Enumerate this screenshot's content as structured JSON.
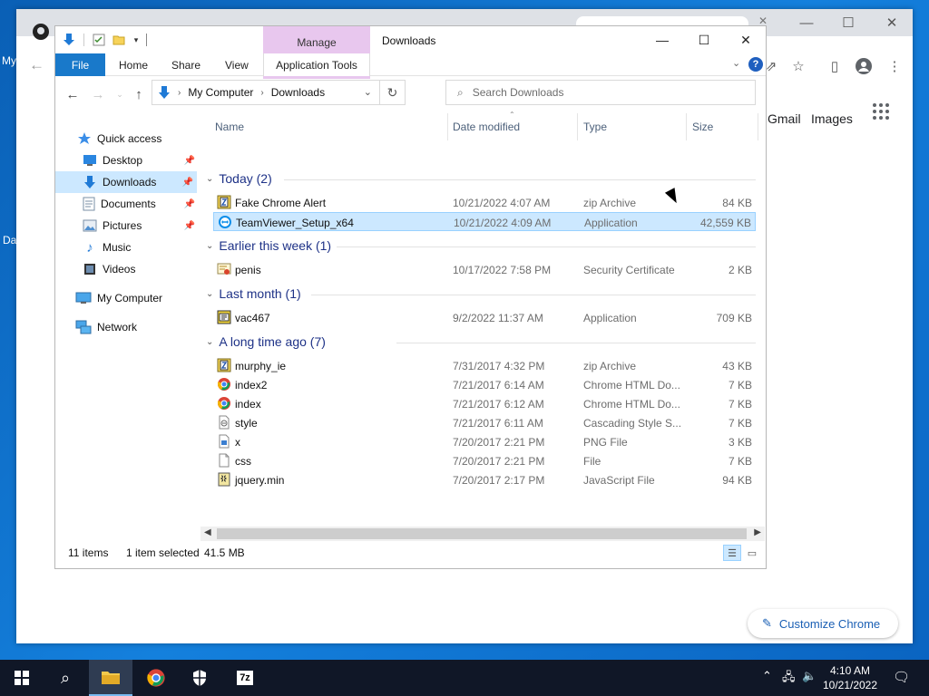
{
  "desktop": {
    "fragments": [
      "My",
      "Da"
    ]
  },
  "chrome": {
    "links": [
      "Gmail",
      "Images"
    ],
    "customize_label": "Customize Chrome"
  },
  "explorer": {
    "title": "Downloads",
    "manage_label": "Manage",
    "ribbon_tabs": [
      "File",
      "Home",
      "Share",
      "View",
      "Application Tools"
    ],
    "breadcrumb": [
      "My Computer",
      "Downloads"
    ],
    "search_placeholder": "Search Downloads",
    "sidebar": [
      {
        "label": "Quick access",
        "icon": "star-icon"
      },
      {
        "label": "Desktop",
        "icon": "desktop-icon",
        "pinned": true
      },
      {
        "label": "Downloads",
        "icon": "download-icon",
        "pinned": true,
        "selected": true
      },
      {
        "label": "Documents",
        "icon": "documents-icon",
        "pinned": true
      },
      {
        "label": "Pictures",
        "icon": "pictures-icon",
        "pinned": true
      },
      {
        "label": "Music",
        "icon": "music-icon"
      },
      {
        "label": "Videos",
        "icon": "videos-icon"
      },
      {
        "label": "My Computer",
        "icon": "computer-icon"
      },
      {
        "label": "Network",
        "icon": "network-icon"
      }
    ],
    "columns": [
      "Name",
      "Date modified",
      "Type",
      "Size"
    ],
    "groups": [
      {
        "title": "Today (2)",
        "files": [
          {
            "name": "Fake Chrome Alert",
            "date": "10/21/2022 4:07 AM",
            "type": "zip Archive",
            "size": "84 KB",
            "icon": "zip-icon"
          },
          {
            "name": "TeamViewer_Setup_x64",
            "date": "10/21/2022 4:09 AM",
            "type": "Application",
            "size": "42,559 KB",
            "icon": "teamviewer-icon",
            "selected": true
          }
        ]
      },
      {
        "title": "Earlier this week (1)",
        "files": [
          {
            "name": "penis",
            "date": "10/17/2022 7:58 PM",
            "type": "Security Certificate",
            "size": "2 KB",
            "icon": "certificate-icon"
          }
        ]
      },
      {
        "title": "Last month (1)",
        "files": [
          {
            "name": "vac467",
            "date": "9/2/2022 11:37 AM",
            "type": "Application",
            "size": "709 KB",
            "icon": "application-icon"
          }
        ]
      },
      {
        "title": "A long time ago (7)",
        "files": [
          {
            "name": "murphy_ie",
            "date": "7/31/2017 4:32 PM",
            "type": "zip Archive",
            "size": "43 KB",
            "icon": "zip-icon"
          },
          {
            "name": "index2",
            "date": "7/21/2017 6:14 AM",
            "type": "Chrome HTML Do...",
            "size": "7 KB",
            "icon": "chrome-html-icon"
          },
          {
            "name": "index",
            "date": "7/21/2017 6:12 AM",
            "type": "Chrome HTML Do...",
            "size": "7 KB",
            "icon": "chrome-html-icon"
          },
          {
            "name": "style",
            "date": "7/21/2017 6:11 AM",
            "type": "Cascading Style S...",
            "size": "7 KB",
            "icon": "css-file-icon"
          },
          {
            "name": "x",
            "date": "7/20/2017 2:21 PM",
            "type": "PNG File",
            "size": "3 KB",
            "icon": "png-file-icon"
          },
          {
            "name": "css",
            "date": "7/20/2017 2:21 PM",
            "type": "File",
            "size": "7 KB",
            "icon": "blank-file-icon"
          },
          {
            "name": "jquery.min",
            "date": "7/20/2017 2:17 PM",
            "type": "JavaScript File",
            "size": "94 KB",
            "icon": "js-file-icon"
          }
        ]
      }
    ],
    "status": {
      "items": "11 items",
      "selected": "1 item selected",
      "size": "41.5 MB"
    }
  },
  "taskbar": {
    "time": "4:10 AM",
    "date": "10/21/2022",
    "sevenzip_label": "7z"
  },
  "colors": {
    "accent": "#1979ca",
    "selection": "#cce8ff",
    "manage_tab": "#e8c7ee",
    "group_title": "#1e3287"
  }
}
